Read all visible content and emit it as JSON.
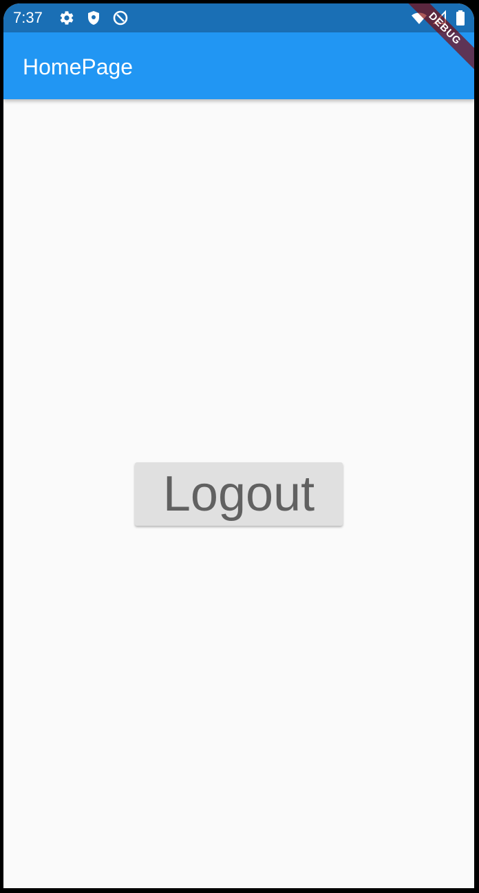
{
  "status_bar": {
    "time": "7:37",
    "left_icons": [
      "gear-icon",
      "shield-icon",
      "no-disturb-icon"
    ],
    "right_icons": [
      "wifi-icon",
      "signal-icon",
      "battery-icon"
    ],
    "color": "#1a6fb5"
  },
  "app_bar": {
    "title": "HomePage",
    "color": "#2196f3"
  },
  "main": {
    "logout_label": "Logout",
    "button_color": "#e0e0e0",
    "label_color": "#616161"
  },
  "debug_banner": {
    "label": "DEBUG"
  }
}
